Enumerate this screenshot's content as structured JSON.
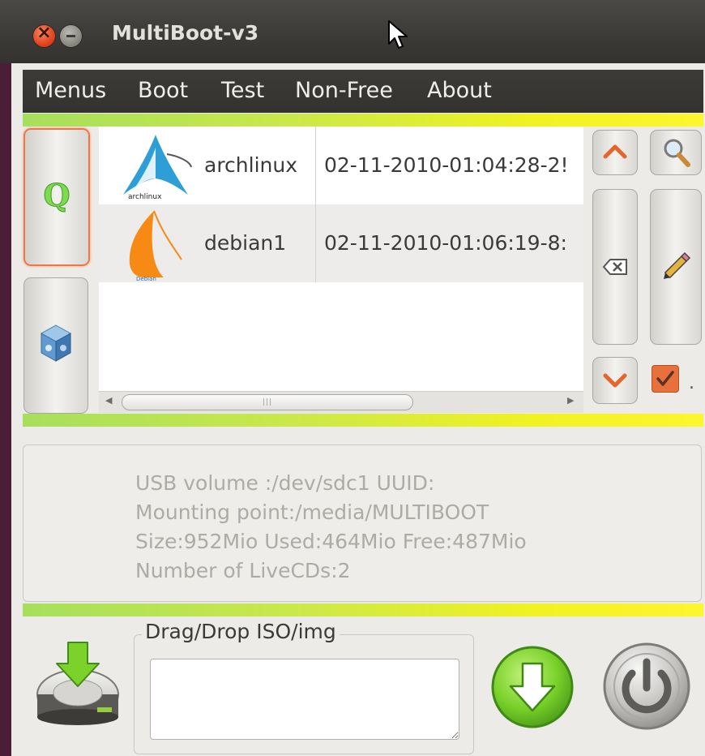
{
  "window": {
    "title": "MultiBoot-v3"
  },
  "menubar": {
    "items": [
      "Menus",
      "Boot",
      "Test",
      "Non-Free",
      "About"
    ]
  },
  "list": {
    "rows": [
      {
        "logo_label": "archlinux",
        "name": "archlinux",
        "date": "02-11-2010-01:04:28-2!"
      },
      {
        "logo_label": "Debian",
        "name": "debian1",
        "date": "02-11-2010-01:06:19-8:"
      }
    ]
  },
  "info": {
    "lines": [
      "USB volume :/dev/sdc1 UUID:",
      "Mounting point:/media/MULTIBOOT",
      "Size:952Mio Used:464Mio Free:487Mio",
      "Number of LiveCDs:2"
    ]
  },
  "dropzone": {
    "label": "Drag/Drop ISO/img",
    "value": ""
  },
  "checkbox": {
    "checked": true,
    "suffix": "."
  },
  "colors": {
    "accent_orange": "#e4662c",
    "green_button": "#7cd12a",
    "gradient_start": "#a6df5d",
    "gradient_end": "#fcf62e"
  },
  "icons": {
    "left_buttons": [
      "qemu-q-icon",
      "virtualbox-icon"
    ],
    "right_buttons": [
      "up-arrow-icon",
      "search-icon",
      "delete-icon",
      "edit-pencil-icon",
      "down-arrow-icon",
      "checkbox-icon"
    ],
    "bottom": [
      "install-disk-icon",
      "download-arrow-icon",
      "power-icon"
    ]
  }
}
